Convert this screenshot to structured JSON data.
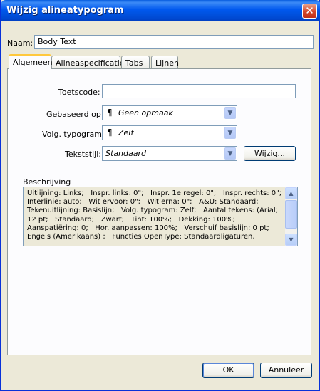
{
  "window": {
    "title": "Wijzig alineatypogram",
    "close_glyph": "✕"
  },
  "name": {
    "label": "Naam:",
    "value": "Body Text"
  },
  "tabs": [
    {
      "label": "Algemeen",
      "active": true
    },
    {
      "label": "Alineaspecificaties",
      "active": false
    },
    {
      "label": "Tabs",
      "active": false
    },
    {
      "label": "Lijnen",
      "active": false
    }
  ],
  "general": {
    "shortcut": {
      "label": "Toetscode:",
      "value": ""
    },
    "based_on": {
      "label": "Gebaseerd op:",
      "icon": "pilcrow-icon",
      "icon_glyph": "¶",
      "value": "Geen opmaak"
    },
    "next_style": {
      "label": "Volg. typogram:",
      "icon": "pilcrow-icon",
      "icon_glyph": "¶",
      "value": "Zelf"
    },
    "text_style": {
      "label": "Tekststijl:",
      "value": "Standaard"
    },
    "edit_button": "Wijzig..."
  },
  "description": {
    "label": "Beschrijving",
    "text": "Uitlijning: Links;   Inspr. links: 0\";   Inspr. 1e regel: 0\";   Inspr. rechts: 0\";\nInterlinie: auto;   Wit ervoor: 0\";   Wit erna: 0\";   A&U: Standaard;\nTekenuitlijning: Basislijn;   Volg. typogram: Zelf;   Aantal tekens: (Arial;\n12 pt;   Standaard;   Zwart;   Tint: 100%;   Dekking: 100%;\nAanspatiëring: 0;   Hor. aanpassen: 100%;   Verschuif basislijn: 0 pt;\nEngels (Amerikaans) ;   Functies OpenType: Standaardligaturen,"
  },
  "buttons": {
    "ok": "OK",
    "cancel": "Annuleer"
  },
  "glyphs": {
    "dropdown": "▼",
    "scroll_up": "▲",
    "scroll_down": "▼"
  },
  "colors": {
    "title_bar": "#0054e3",
    "close_button": "#d4462a",
    "active_tab_accent": "#ffc83c"
  }
}
